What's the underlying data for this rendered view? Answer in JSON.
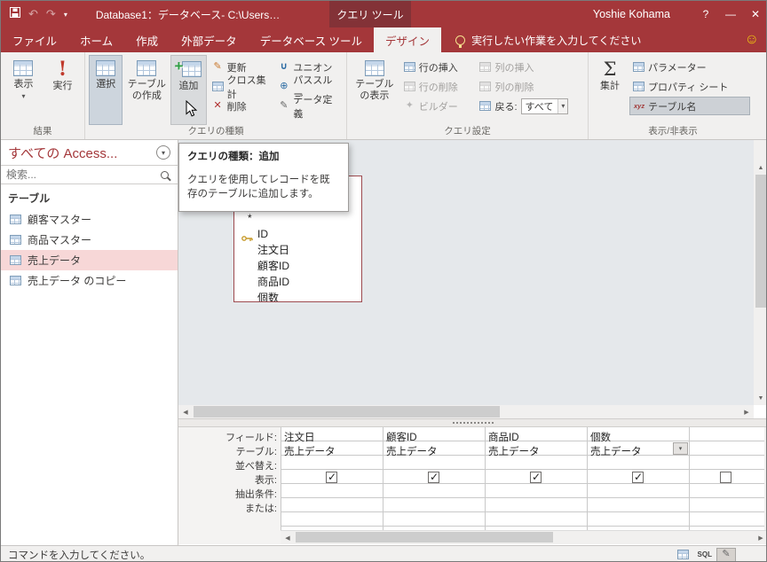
{
  "window": {
    "title": "Database1：データベース- C:\\Users…",
    "contextual_tab_label": "クエリ ツール",
    "user_name": "Yoshie Kohama",
    "help_glyph": "?",
    "minimize_glyph": "—",
    "close_glyph": "✕"
  },
  "qat": {
    "undo_glyph": "↶",
    "redo_glyph": "↷",
    "dropdown_glyph": "▾"
  },
  "tabs": {
    "file": "ファイル",
    "home": "ホーム",
    "create": "作成",
    "external_data": "外部データ",
    "db_tools": "データベース ツール",
    "design": "デザイン"
  },
  "tell_me": {
    "text": "実行したい作業を入力してください"
  },
  "smiley_glyph": "☺",
  "ribbon": {
    "results": {
      "label": "結果",
      "view": "表示",
      "view_arrow": "▾",
      "run": "実行",
      "run_glyph": "!"
    },
    "query_type": {
      "label": "クエリの種類",
      "select": "選択",
      "make_table": "テーブルの作成",
      "append": "追加",
      "append_plus": "+",
      "update": "更新",
      "crosstab": "クロス集計",
      "delete": "削除",
      "delete_glyph": "✕",
      "update_glyph": "✎",
      "union": "ユニオン",
      "union_glyph": "∪",
      "pass_through": "パススルー",
      "pass_glyph": "⊕",
      "data_definition": "データ定義",
      "datadef_glyph": "✎"
    },
    "query_setup": {
      "label": "クエリ設定",
      "show_table": "テーブルの表示",
      "insert_rows": "行の挿入",
      "delete_rows": "行の削除",
      "builder": "ビルダー",
      "builder_glyph": "✦",
      "insert_columns": "列の挿入",
      "delete_columns": "列の削除",
      "return_label": "戻る:",
      "return_value": "すべて",
      "combo_arrow": "▾"
    },
    "show_hide": {
      "label": "表示/非表示",
      "totals": "集計",
      "sigma_glyph": "Σ",
      "parameters": "パラメーター",
      "property_sheet": "プロパティ シート",
      "table_names": "テーブル名",
      "xyz_glyph": "xyz"
    }
  },
  "tooltip": {
    "title": "クエリの種類：追加",
    "body": "クエリを使用してレコードを既存のテーブルに追加します。"
  },
  "nav": {
    "header": "すべての Access...",
    "menu_glyph": "▾",
    "search_placeholder": "検索...",
    "group_label": "テーブル",
    "items": [
      {
        "label": "顧客マスター",
        "selected": false
      },
      {
        "label": "商品マスター",
        "selected": false
      },
      {
        "label": "売上データ",
        "selected": true
      },
      {
        "label": "売上データ のコピー",
        "selected": false
      }
    ]
  },
  "field_list": {
    "items": [
      {
        "name": "*",
        "key": false
      },
      {
        "name": "ID",
        "key": true
      },
      {
        "name": "注文日",
        "key": false
      },
      {
        "name": "顧客ID",
        "key": false
      },
      {
        "name": "商品ID",
        "key": false
      },
      {
        "name": "個数",
        "key": false
      }
    ]
  },
  "doc_close_glyph": "✕",
  "scroll": {
    "left": "◀",
    "right": "▶",
    "up": "▲",
    "down": "▼"
  },
  "grid": {
    "row_labels": [
      "フィールド:",
      "テーブル:",
      "並べ替え:",
      "表示:",
      "抽出条件:",
      "または:"
    ],
    "columns": [
      {
        "field": "注文日",
        "table": "売上データ",
        "show": true,
        "active": false
      },
      {
        "field": "顧客ID",
        "table": "売上データ",
        "show": true,
        "active": false
      },
      {
        "field": "商品ID",
        "table": "売上データ",
        "show": true,
        "active": false
      },
      {
        "field": "個数",
        "table": "売上データ",
        "show": true,
        "active": true
      },
      {
        "field": "",
        "table": "",
        "show": false,
        "active": false
      }
    ],
    "combo_arrow": "▾"
  },
  "status": {
    "message": "コマンドを入力してください。",
    "sql_label": "SQL"
  },
  "colors": {
    "accent": "#A4373A",
    "contextual_tab": "#833237",
    "selection_pink": "#F7D7D7",
    "ribbon_bg": "#F1F0EF",
    "design_bg": "#E5E8EB",
    "highlight": "#CDD5DD"
  }
}
